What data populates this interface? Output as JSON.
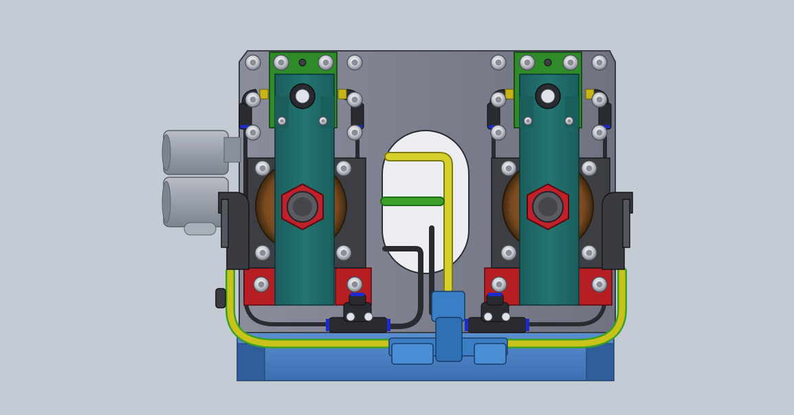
{
  "scene": {
    "background": "#c5cbd5",
    "subject": "pneumatic-valve-manifold-cad-assembly"
  },
  "colors": {
    "plate": "#7e818f",
    "plate_edge": "#3a3c46",
    "base_block": "#4a7ec0",
    "base_block_dark": "#2f5f9a",
    "coil_body": "#1f6c6a",
    "coil_body_light": "#2c8a86",
    "coil_mount": "#2f8a2a",
    "valve_disc": "#8a5a2a",
    "nut": "#c0202a",
    "clamp_block": "#b51e22",
    "tube_yellow": "#c8c21a",
    "tube_green": "#3aa028",
    "tube_black": "#2a2b30",
    "fitting_blue": "#3a7fc6",
    "fitting_black": "#3a3b40",
    "ring_blue": "#1a2cd0",
    "brass": "#c8b418",
    "silencer": "#9aa0aa"
  },
  "components": {
    "left_valve": "solenoid-valve-left",
    "right_valve": "solenoid-valve-right",
    "manifold": "blue-manifold-block",
    "tee": "blue-tee-fitting",
    "silencers": "silencer-pair"
  }
}
